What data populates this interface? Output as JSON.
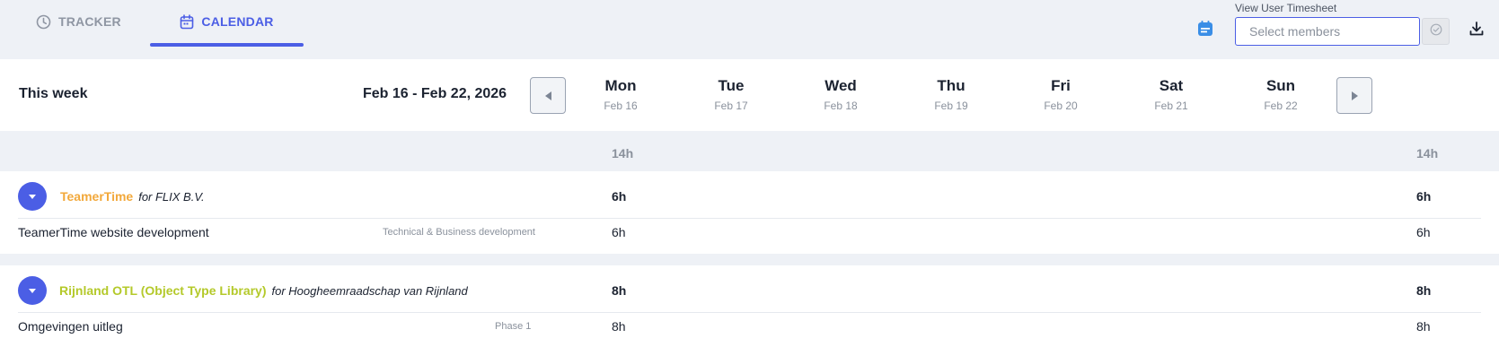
{
  "tabs": {
    "tracker": "TRACKER",
    "calendar": "CALENDAR"
  },
  "topbar": {
    "view_user_label": "View User Timesheet",
    "member_placeholder": "Select members"
  },
  "week": {
    "title": "This week",
    "range": "Feb 16 - Feb 22, 2026",
    "days": [
      {
        "name": "Mon",
        "date": "Feb 16"
      },
      {
        "name": "Tue",
        "date": "Feb 17"
      },
      {
        "name": "Wed",
        "date": "Feb 18"
      },
      {
        "name": "Thu",
        "date": "Feb 19"
      },
      {
        "name": "Fri",
        "date": "Feb 20"
      },
      {
        "name": "Sat",
        "date": "Feb 21"
      },
      {
        "name": "Sun",
        "date": "Feb 22"
      }
    ]
  },
  "totals": {
    "mon": "14h",
    "sum": "14h"
  },
  "projects": [
    {
      "name": "TeamerTime",
      "client": "for FLIX B.V.",
      "color": "#f2a83a",
      "mon": "6h",
      "sum": "6h",
      "task": {
        "name": "TeamerTime website development",
        "category": "Technical & Business development",
        "mon": "6h",
        "sum": "6h"
      }
    },
    {
      "name": "Rijnland OTL (Object Type Library)",
      "client": "for Hoogheemraadschap van Rijnland",
      "color": "#b4c92a",
      "mon": "8h",
      "sum": "8h",
      "task": {
        "name": "Omgevingen uitleg",
        "category": "Phase 1",
        "mon": "8h",
        "sum": "8h"
      }
    }
  ],
  "colors": {
    "accent": "#4b5ee5",
    "icon_blue": "#3a8ee6"
  }
}
